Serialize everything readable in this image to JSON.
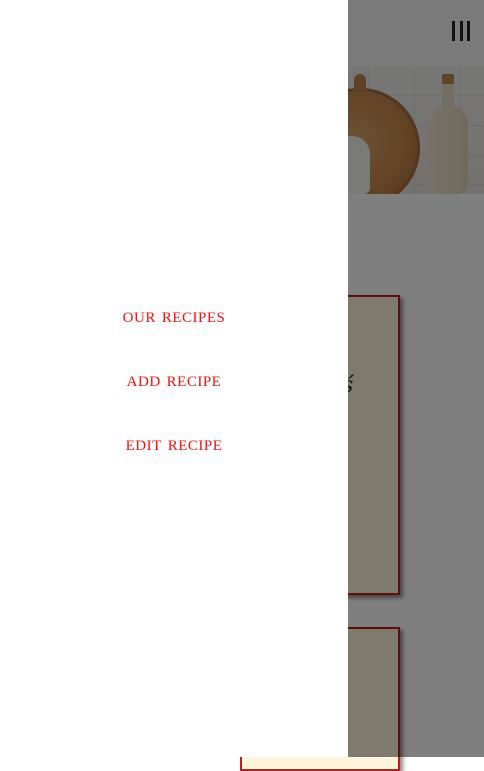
{
  "header": {
    "menu_icon": "hamburger-menu-icon"
  },
  "hero": {
    "image": "kitchen-shelf-photo"
  },
  "drawer": {
    "links": [
      {
        "label": "OUR RECIPES"
      },
      {
        "label": "ADD RECIPE"
      },
      {
        "label": "EDIT RECIPE"
      }
    ]
  },
  "colors": {
    "link": "#ff0d0d",
    "card_border": "#c31b1b",
    "card_fill": "#fdf5da",
    "overlay": "rgba(0,0,0,0.5)"
  }
}
